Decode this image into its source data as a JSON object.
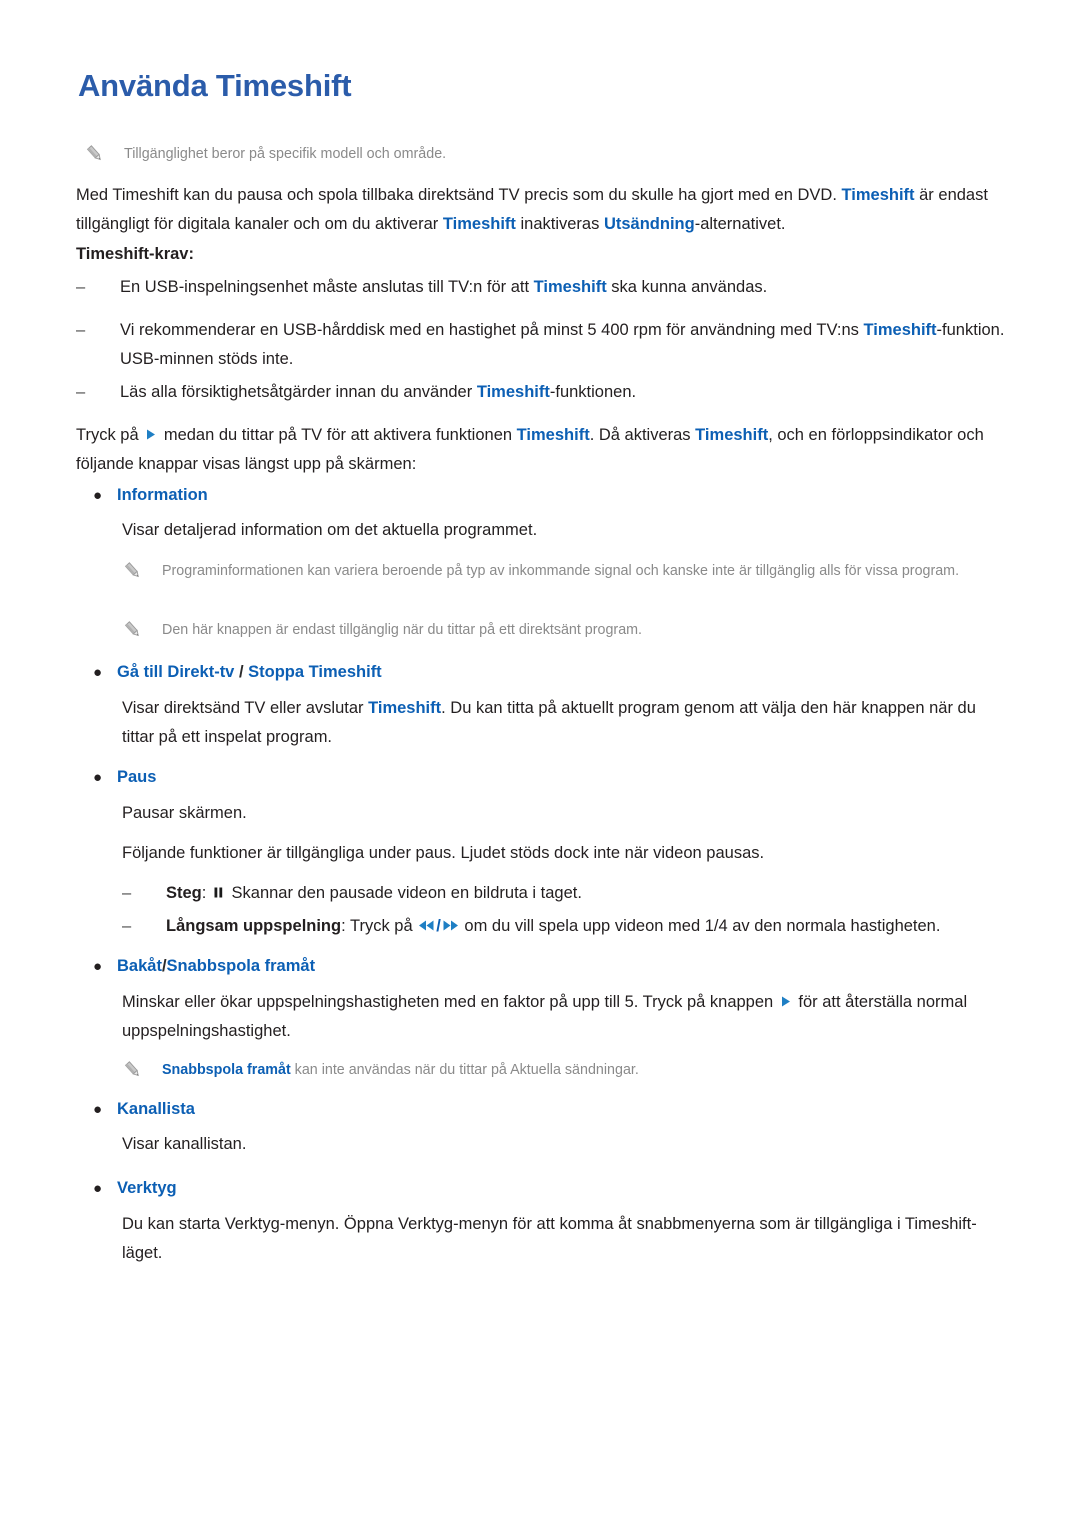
{
  "document": {
    "title": "Använda Timeshift",
    "language": "sv"
  },
  "colors": {
    "heading_blue": "#2b5caa",
    "link_blue": "#0c5fb4",
    "body_text": "#231f20",
    "note_text": "#8a8a8a",
    "page_background": "#ffffff"
  },
  "notes": {
    "availability": "Tillgänglighet beror på specifik modell och område.",
    "program_info": {
      "text": "Programinformationen kan variera beroende på typ av inkommande signal och kanske inte är tillgänglig alls för vissa program."
    },
    "live_only": "Den här knappen är endast tillgänglig när du tittar på ett direktsänt program.",
    "fast_forward": {
      "highlight": "Snabbspola framåt",
      "rest": " kan inte användas när du tittar på Aktuella sändningar."
    }
  },
  "intro": {
    "line1_a": "Med Timeshift kan du pausa och spola tillbaka direktsänd TV precis som du skulle ha gjort med en DVD. ",
    "line1_hl": "Timeshift",
    "line2_a": " är endast tillgängligt för digitala kanaler och om du aktiverar ",
    "line2_hl1": "Timeshift",
    "line2_b": " inaktiveras ",
    "line2_hl2": "Utsändning",
    "line2_c": "-alternativet."
  },
  "requirements": {
    "heading": "Timeshift-krav:",
    "items": [
      {
        "before": "En USB-inspelningsenhet måste anslutas till TV:n för att ",
        "highlight": "Timeshift",
        "after": " ska kunna användas."
      },
      {
        "before": "Vi rekommenderar en USB-hårddisk med en hastighet på minst 5 400 rpm för användning med TV:ns ",
        "highlight": "Timeshift",
        "after": "-funktion. USB-minnen stöds inte."
      },
      {
        "before": "Läs alla försiktighetsåtgärder innan du använder ",
        "highlight": "Timeshift",
        "after": "-funktionen."
      }
    ]
  },
  "activation": {
    "a": "Tryck på ",
    "icon": "play-icon",
    "b": " medan du tittar på TV för att aktivera funktionen ",
    "hl1": "Timeshift",
    "c": ". Då aktiveras ",
    "hl2": "Timeshift",
    "d": ", och en förloppsindikator och följande knappar visas längst upp på skärmen:"
  },
  "buttons": {
    "information": {
      "label": "Information",
      "description": "Visar detaljerad information om det aktuella programmet."
    },
    "live_tv": {
      "label_a": "Gå till Direkt-tv",
      "separator": " / ",
      "label_b": "Stoppa Timeshift",
      "desc_a": "Visar direktsänd TV eller avslutar ",
      "desc_hl": "Timeshift",
      "desc_b": ". Du kan titta på aktuellt program genom att välja den här knappen när du tittar på ett inspelat program."
    },
    "pause": {
      "label": "Paus",
      "desc1": "Pausar skärmen.",
      "desc2": "Följande funktioner är tillgängliga under paus. Ljudet stöds dock inte när videon pausas.",
      "sub_items": [
        {
          "term": "Steg",
          "colon": ": ",
          "icon": "pause-icon",
          "text": " Skannar den pausade videon en bildruta i taget."
        },
        {
          "term": "Långsam uppspelning",
          "colon": ": ",
          "text_a": "Tryck på ",
          "icon_a": "rewind-icon",
          "slash": "/",
          "icon_b": "fast-forward-icon",
          "text_b": " om du vill spela upp videon med 1/4 av den normala hastigheten."
        }
      ]
    },
    "rewind_ff": {
      "label_a": "Bakåt",
      "separator": "/",
      "label_b": "Snabbspola framåt",
      "desc_a": "Minskar eller ökar uppspelningshastigheten med en faktor på upp till 5. Tryck på knappen ",
      "desc_icon": "play-icon",
      "desc_b": " för att återställa normal uppspelningshastighet."
    },
    "channel_list": {
      "label": "Kanallista",
      "description": "Visar kanallistan."
    },
    "tools": {
      "label": "Verktyg",
      "description": "Du kan starta Verktyg-menyn. Öppna Verktyg-menyn för att komma åt snabbmenyerna som är tillgängliga i Timeshift-läget."
    }
  }
}
